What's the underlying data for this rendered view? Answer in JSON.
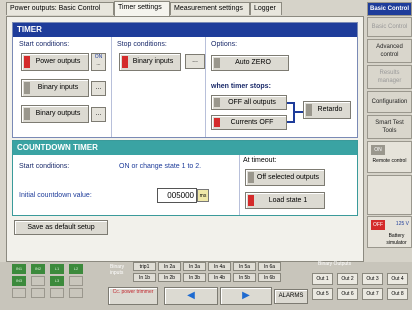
{
  "tabs": [
    {
      "label": "Power outputs: Basic Control"
    },
    {
      "label": "Timer settings"
    },
    {
      "label": "Measurement settings"
    },
    {
      "label": "Logger"
    }
  ],
  "timer": {
    "title": "TIMER",
    "start_label": "Start conditions:",
    "start_buttons": [
      {
        "label": "Power outputs",
        "indicator": "ON"
      },
      {
        "label": "Binary inputs"
      },
      {
        "label": "Binary outputs"
      }
    ],
    "stop_label": "Stop conditions:",
    "stop_button": "Binary inputs",
    "options_label": "Options:",
    "auto_zero": "Auto ZERO",
    "when_stops": "when timer stops:",
    "off_all": "OFF all outputs",
    "currents_off": "Currents OFF",
    "retardo": "Retardo"
  },
  "countdown": {
    "title": "COUNTDOWN TIMER",
    "start_label": "Start conditions:",
    "start_value": "ON or change state 1 to 2.",
    "initial_label": "Initial countdown value:",
    "value": "005000",
    "unit": "ms",
    "at_timeout": "At timeout:",
    "off_selected": "Off selected outputs",
    "load_state": "Load state 1"
  },
  "save_default": "Save as default setup",
  "sidebar": {
    "items": [
      {
        "label": "Basic Control"
      },
      {
        "label": "Basic Control"
      },
      {
        "label": "Advanced control"
      },
      {
        "label": "Results manager"
      },
      {
        "label": "Configuration"
      },
      {
        "label": "Smart Test Tools"
      },
      {
        "label": "Remote control",
        "toggle": "ON"
      },
      {
        "label": "Battery simulator",
        "toggle": "OFF",
        "value": "125 V"
      }
    ]
  },
  "bottom": {
    "binary_inputs_label": "Binary inputs",
    "binary_outputs_label": "Binary Outputs",
    "inputs_row1": [
      "trip1",
      "In 2a",
      "In 3a",
      "In 4a",
      "In 5a",
      "In 6a"
    ],
    "inputs_row2": [
      "In 1b",
      "In 2b",
      "In 3b",
      "In 4b",
      "In 5b",
      "In 6b"
    ],
    "outputs": [
      "Out 1",
      "Out 2",
      "Out 3",
      "Out 4",
      "Out 5",
      "Out 6",
      "Out 7",
      "Out 8"
    ],
    "power_btn": "Cc. power trimmer",
    "alarms": "ALARMS",
    "status_leds": [
      "IN1",
      "IN2",
      "L1",
      "L2",
      "IN3",
      "L3"
    ]
  }
}
